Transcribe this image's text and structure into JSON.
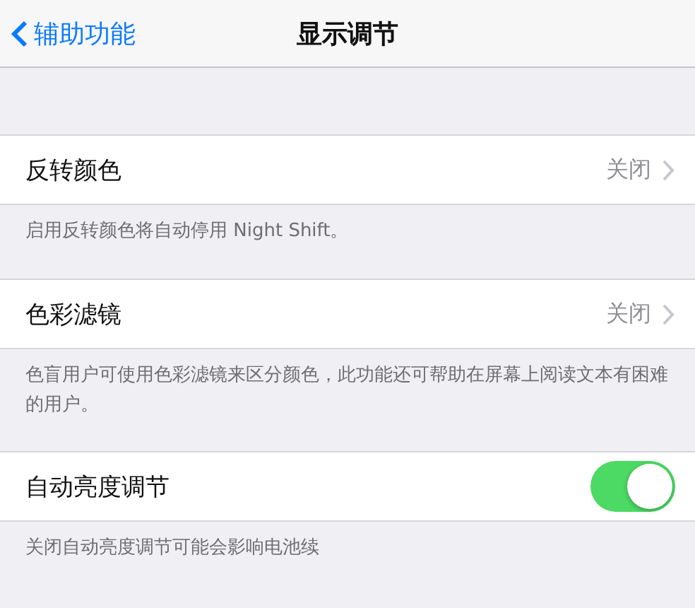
{
  "nav": {
    "back": "辅助功能",
    "title": "显示调节"
  },
  "sections": [
    {
      "kind": "disclosure",
      "label": "反转颜色",
      "value": "关闭",
      "footer": "启用反转颜色将自动停用 Night Shift。"
    },
    {
      "kind": "disclosure",
      "label": "色彩滤镜",
      "value": "关闭",
      "footer": "色盲用户可使用色彩滤镜来区分颜色，此功能还可帮助在屏幕上阅读文本有困难的用户。"
    },
    {
      "kind": "toggle",
      "label": "自动亮度调节",
      "on": true,
      "footer": "关闭自动亮度调节可能会影响电池续"
    }
  ]
}
